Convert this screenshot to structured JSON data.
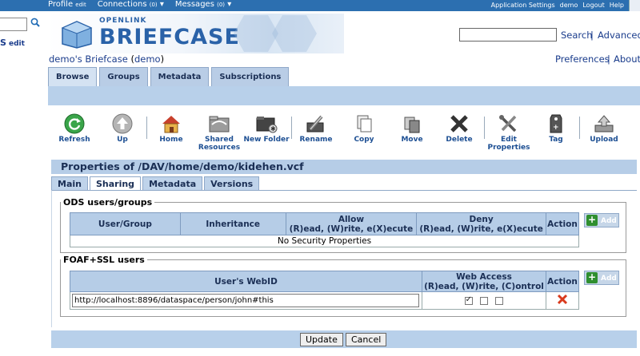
{
  "topbar": {
    "profile": "Profile",
    "profile_edit": "edit",
    "connections": "Connections",
    "connections_count": "(0)",
    "messages": "Messages",
    "messages_count": "(0)",
    "app_settings": "Application Settings",
    "user": "demo",
    "logout": "Logout",
    "help": "Help"
  },
  "sidebar": {
    "s_label": "S",
    "edit": "edit"
  },
  "logo": {
    "line1": "OPENLINK",
    "line2": "BRIEFCASE"
  },
  "header_search": {
    "search": "Search",
    "sep": "|",
    "advanced": "Advanced"
  },
  "breadcrumb": {
    "briefcase": "demo's Briefcase",
    "paren_open": "(",
    "user": "demo",
    "paren_close": ")"
  },
  "header_links": {
    "preferences": "Preferences",
    "sep": "|",
    "about": "About"
  },
  "tabs": [
    {
      "label": "Browse"
    },
    {
      "label": "Groups"
    },
    {
      "label": "Metadata"
    },
    {
      "label": "Subscriptions"
    }
  ],
  "toolbar": {
    "refresh": "Refresh",
    "up": "Up",
    "home": "Home",
    "shared": "Shared Resources",
    "new_folder": "New Folder",
    "rename": "Rename",
    "copy": "Copy",
    "move": "Move",
    "delete": "Delete",
    "edit_properties": "Edit Properties",
    "tag": "Tag",
    "upload": "Upload"
  },
  "properties_title": "Properties of /DAV/home/demo/kidehen.vcf",
  "sub_tabs": [
    {
      "label": "Main"
    },
    {
      "label": "Sharing"
    },
    {
      "label": "Metadata"
    },
    {
      "label": "Versions"
    }
  ],
  "ods_section": {
    "legend": "ODS users/groups",
    "col_user": "User/Group",
    "col_inheritance": "Inheritance",
    "col_allow_1": "Allow",
    "col_allow_2": "(R)ead, (W)rite, e(X)ecute",
    "col_deny_1": "Deny",
    "col_deny_2": "(R)ead, (W)rite, e(X)ecute",
    "col_action": "Action",
    "empty_row": "No Security Properties",
    "add": "Add"
  },
  "foaf_section": {
    "legend": "FOAF+SSL users",
    "col_webid": "User's WebID",
    "col_access_1": "Web Access",
    "col_access_2": "(R)ead, (W)rite, (C)ontrol",
    "col_action": "Action",
    "webid_value": "http://localhost:8896/dataspace/person/john#this",
    "add": "Add"
  },
  "buttons": {
    "update": "Update",
    "cancel": "Cancel"
  }
}
